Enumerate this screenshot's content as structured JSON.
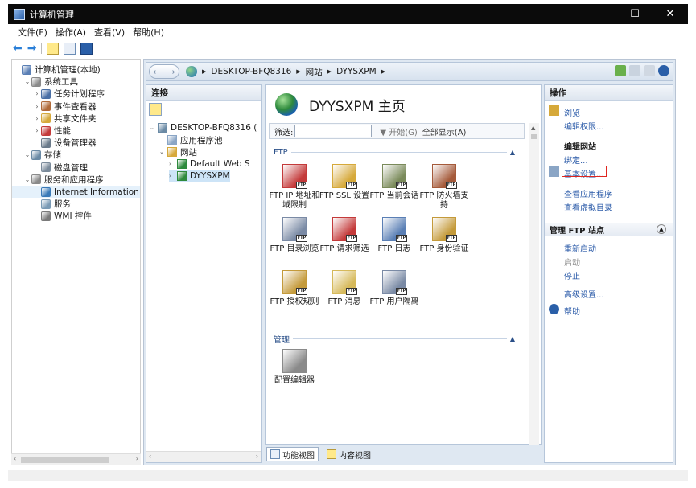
{
  "window": {
    "title": "计算机管理",
    "minimize": "—",
    "maximize": "☐",
    "close": "✕"
  },
  "menu": [
    "文件(F)",
    "操作(A)",
    "查看(V)",
    "帮助(H)"
  ],
  "left_tree": [
    {
      "label": "计算机管理(本地)",
      "indent": 0,
      "exp": "",
      "color": "#5a7fb5"
    },
    {
      "label": "系统工具",
      "indent": 1,
      "exp": "⌄",
      "color": "#8a8a8a"
    },
    {
      "label": "任务计划程序",
      "indent": 2,
      "exp": "›",
      "color": "#4a6fa5"
    },
    {
      "label": "事件查看器",
      "indent": 2,
      "exp": "›",
      "color": "#b06a3a"
    },
    {
      "label": "共享文件夹",
      "indent": 2,
      "exp": "›",
      "color": "#d6a93a"
    },
    {
      "label": "性能",
      "indent": 2,
      "exp": "›",
      "color": "#c43a3a"
    },
    {
      "label": "设备管理器",
      "indent": 2,
      "exp": "",
      "color": "#6a7a8a"
    },
    {
      "label": "存储",
      "indent": 1,
      "exp": "⌄",
      "color": "#6a8aa5"
    },
    {
      "label": "磁盘管理",
      "indent": 2,
      "exp": "",
      "color": "#7a8a9a"
    },
    {
      "label": "服务和应用程序",
      "indent": 1,
      "exp": "⌄",
      "color": "#8a8a8a"
    },
    {
      "label": "Internet Information Se",
      "indent": 2,
      "exp": "",
      "color": "#3a7ab8",
      "selected": true
    },
    {
      "label": "服务",
      "indent": 2,
      "exp": "",
      "color": "#7a9ab5"
    },
    {
      "label": "WMI 控件",
      "indent": 2,
      "exp": "",
      "color": "#7a7a7a"
    }
  ],
  "address": {
    "crumbs": [
      "DESKTOP-BFQ8316",
      "网站",
      "DYYSXPM"
    ]
  },
  "connections": {
    "header": "连接",
    "tree": [
      {
        "label": "DESKTOP-BFQ8316 (",
        "indent": 0,
        "exp": "⌄",
        "color": "#6a8aa5"
      },
      {
        "label": "应用程序池",
        "indent": 1,
        "exp": "",
        "color": "#8aa5c5"
      },
      {
        "label": "网站",
        "indent": 1,
        "exp": "⌄",
        "color": "#d6a93a"
      },
      {
        "label": "Default Web S",
        "indent": 2,
        "exp": "›",
        "color": "#2e8a3c"
      },
      {
        "label": "DYYSXPM",
        "indent": 2,
        "exp": "›",
        "color": "#2e8a3c",
        "selected": true
      }
    ]
  },
  "center": {
    "title": "DYYSXPM 主页",
    "filter": {
      "label": "筛选:",
      "go": "▼ 开始(G)",
      "show_all": "全部显示(A)"
    },
    "groups": [
      {
        "name": "FTP",
        "items": [
          {
            "label": "FTP IP 地址和域限制",
            "color": "#c43a3a"
          },
          {
            "label": "FTP SSL 设置",
            "color": "#d6a93a"
          },
          {
            "label": "FTP 当前会话",
            "color": "#7a8a5a"
          },
          {
            "label": "FTP 防火墙支持",
            "color": "#a55a3a"
          },
          {
            "label": "FTP 目录浏览",
            "color": "#7a8aa5"
          },
          {
            "label": "FTP 请求筛选",
            "color": "#c43a3a"
          },
          {
            "label": "FTP 日志",
            "color": "#5a7fb5"
          },
          {
            "label": "FTP 身份验证",
            "color": "#c49a3a"
          },
          {
            "label": "FTP 授权规则",
            "color": "#c49a3a"
          },
          {
            "label": "FTP 消息",
            "color": "#d6b95a"
          },
          {
            "label": "FTP 用户隔离",
            "color": "#7a8aa5"
          }
        ]
      },
      {
        "name": "管理",
        "items": [
          {
            "label": "配置编辑器",
            "color": "#8a8a8a"
          }
        ]
      }
    ],
    "badge": "FTP"
  },
  "view_tabs": [
    "功能视图",
    "内容视图"
  ],
  "actions": {
    "header": "操作",
    "items": [
      {
        "label": "浏览",
        "style": "link",
        "icon": true
      },
      {
        "label": "编辑权限...",
        "style": "link"
      },
      {
        "label": "编辑网站",
        "style": "bold"
      },
      {
        "label": "绑定...",
        "style": "link"
      },
      {
        "label": "基本设置...",
        "style": "link",
        "icon": true,
        "highlight": true
      },
      {
        "label": "查看应用程序",
        "style": "link"
      },
      {
        "label": "查看虚拟目录",
        "style": "link"
      }
    ],
    "ftp_section": "管理 FTP 站点",
    "ftp_items": [
      {
        "label": "重新启动",
        "style": "link"
      },
      {
        "label": "启动",
        "style": "gray"
      },
      {
        "label": "停止",
        "style": "link"
      },
      {
        "label": "高级设置...",
        "style": "link"
      },
      {
        "label": "帮助",
        "style": "link",
        "icon": true
      }
    ]
  }
}
